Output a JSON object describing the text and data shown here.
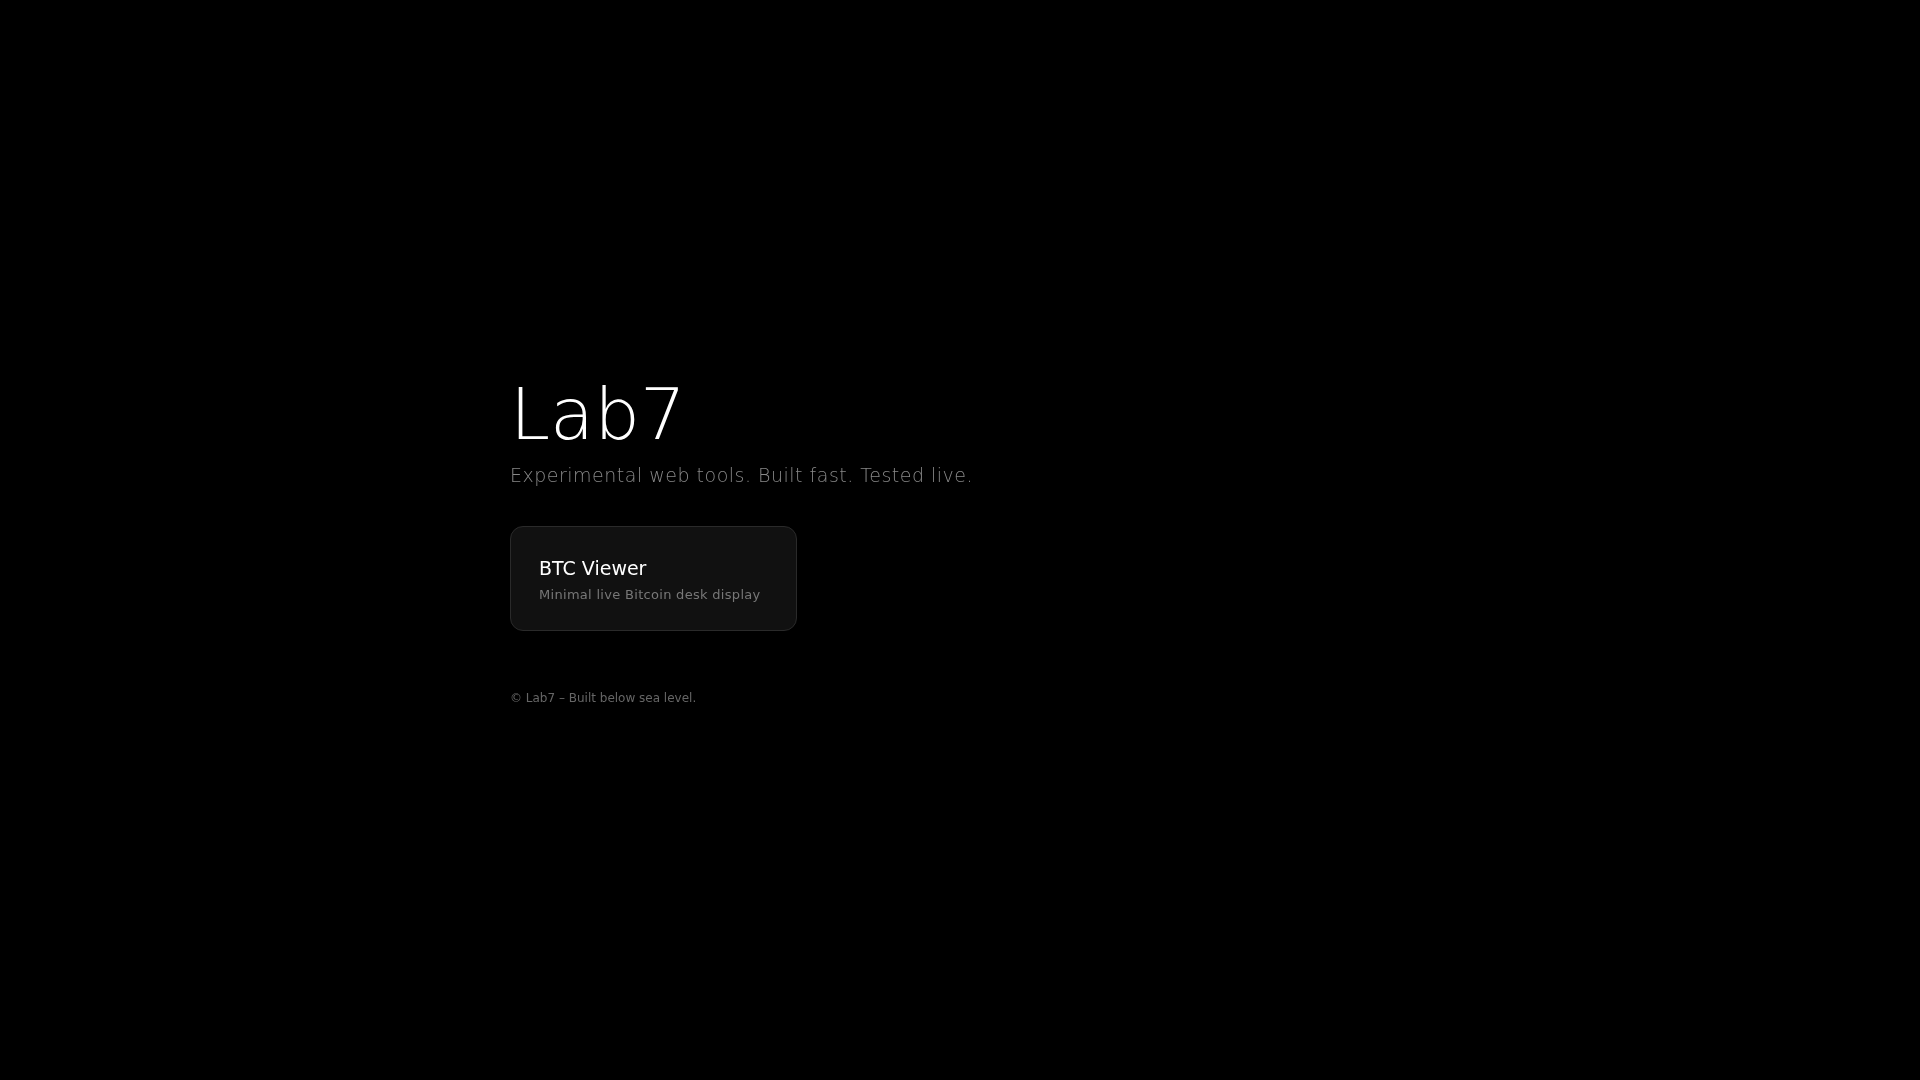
{
  "title": "Lab7",
  "tagline": "Experimental web tools. Built fast. Tested live.",
  "projects": [
    {
      "name": "BTC Viewer",
      "description": "Minimal live Bitcoin desk display"
    }
  ],
  "footer": "© Lab7 – Built below sea level."
}
